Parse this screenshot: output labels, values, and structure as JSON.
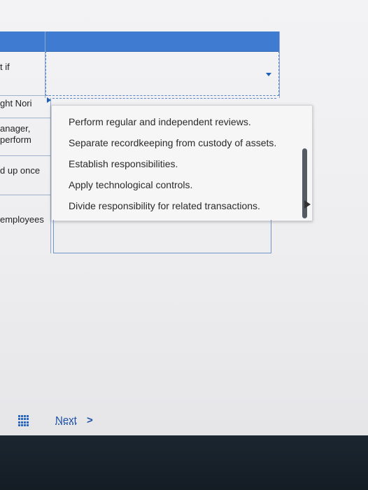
{
  "row_labels": [
    "t if",
    "ght Nori",
    "anager,",
    "perform",
    "d up once",
    "employees"
  ],
  "dropdown": {
    "options": [
      "Perform regular and independent reviews.",
      "Separate recordkeeping from custody of assets.",
      "Establish responsibilities.",
      "Apply technological controls.",
      "Divide responsibility for related transactions."
    ]
  },
  "footer": {
    "next_label": "Next",
    "next_chevron": ">"
  },
  "colors": {
    "header_blue": "#3f7bd1",
    "link_blue": "#1b4fa8",
    "bottom_bar": "#141c24"
  },
  "icons": [
    "grid-menu-icon",
    "chevron-right-icon",
    "dropdown-arrow-icon",
    "mouse-cursor-icon"
  ]
}
